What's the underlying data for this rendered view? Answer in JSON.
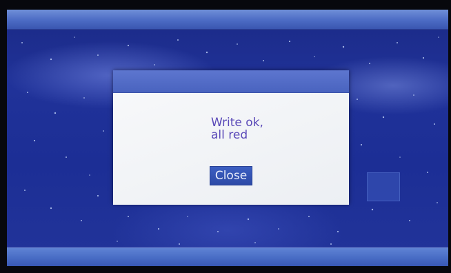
{
  "dialog": {
    "message": "Write ok,\nall red",
    "close_label": "Close"
  },
  "colors": {
    "background": "#1f3196",
    "bar": "#4c6bc4",
    "dialog_title": "#5469c7",
    "dialog_body": "#f1f3f6",
    "message_text": "#5a49b8",
    "button": "#3455b8"
  }
}
